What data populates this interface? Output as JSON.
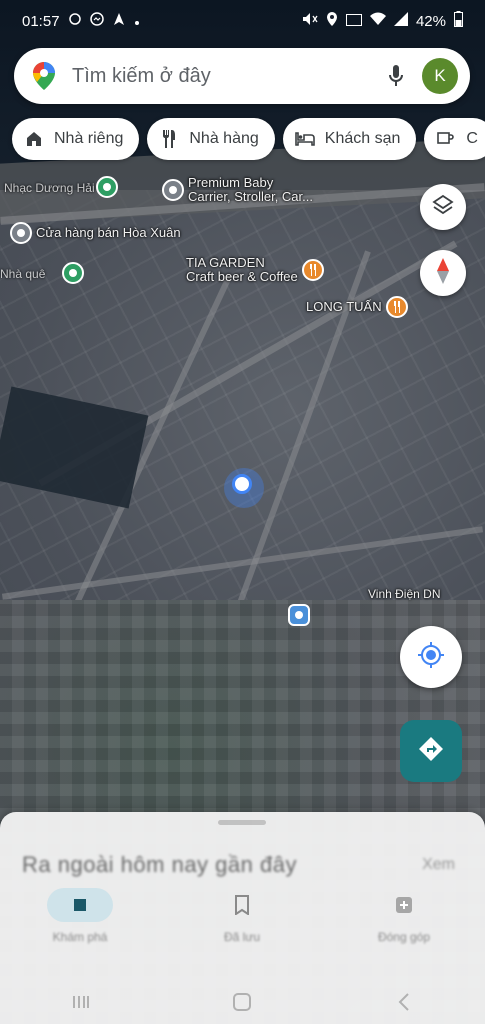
{
  "status_bar": {
    "time": "01:57",
    "battery": "42%"
  },
  "search": {
    "placeholder": "Tìm kiếm ở đây",
    "avatar_letter": "K"
  },
  "chips": [
    {
      "label": "Nhà riêng",
      "icon": "home-icon"
    },
    {
      "label": "Nhà hàng",
      "icon": "restaurant-icon"
    },
    {
      "label": "Khách sạn",
      "icon": "hotel-icon"
    },
    {
      "label": "C",
      "icon": "coffee-icon"
    }
  ],
  "map_labels": {
    "poi_premium_baby": "Premium Baby\nCarrier, Stroller, Car...",
    "poi_cua_hang": "Cửa hàng bán Hòa Xuân",
    "poi_tia_garden": "TIA GARDEN\nCraft beer & Coffee",
    "poi_long_tuan": "LONG TUẤN",
    "poi_vinh_dien": "Vinh Điện DN",
    "poi_topleft": "Nhạc Dương Hải",
    "poi_left_mid": "Nhà quê"
  },
  "bottom_sheet": {
    "title": "Ra ngoài hôm nay gần đây",
    "more": "Xem",
    "tabs": [
      {
        "label": "Khám phá",
        "icon": "explore-icon"
      },
      {
        "label": "Đã lưu",
        "icon": "saved-icon"
      },
      {
        "label": "Đóng góp",
        "icon": "contribute-icon"
      }
    ]
  },
  "colors": {
    "accent_blue": "#4285f4",
    "poi_green": "#2e9e63",
    "poi_orange": "#e8892c",
    "poi_gray": "#7a8088",
    "avatar_green": "#5a8a2c",
    "directions_teal": "#1a7a80"
  }
}
